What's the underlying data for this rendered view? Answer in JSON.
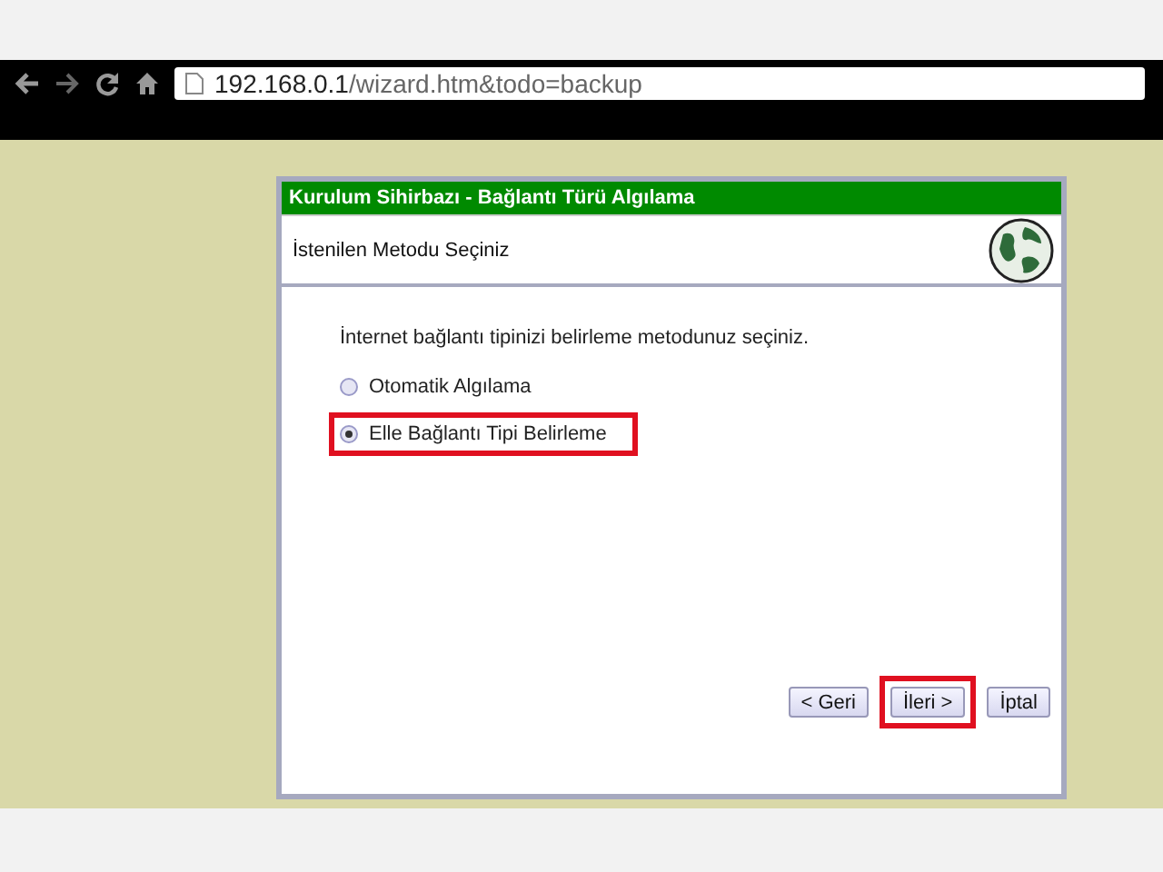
{
  "browser": {
    "url_host": "192.168.0.1",
    "url_path": "/wizard.htm&todo=backup"
  },
  "wizard": {
    "title": "Kurulum Sihirbazı - Bağlantı Türü Algılama",
    "subtitle": "İstenilen Metodu Seçiniz",
    "prompt": "İnternet bağlantı tipinizi belirleme metodunuz seçiniz.",
    "options": [
      {
        "label": "Otomatik Algılama",
        "selected": false,
        "highlighted": false
      },
      {
        "label": "Elle Bağlantı Tipi Belirleme",
        "selected": true,
        "highlighted": true
      }
    ],
    "buttons": [
      {
        "label": "< Geri",
        "highlighted": false
      },
      {
        "label": "İleri >",
        "highlighted": true
      },
      {
        "label": "İptal",
        "highlighted": false
      }
    ]
  }
}
